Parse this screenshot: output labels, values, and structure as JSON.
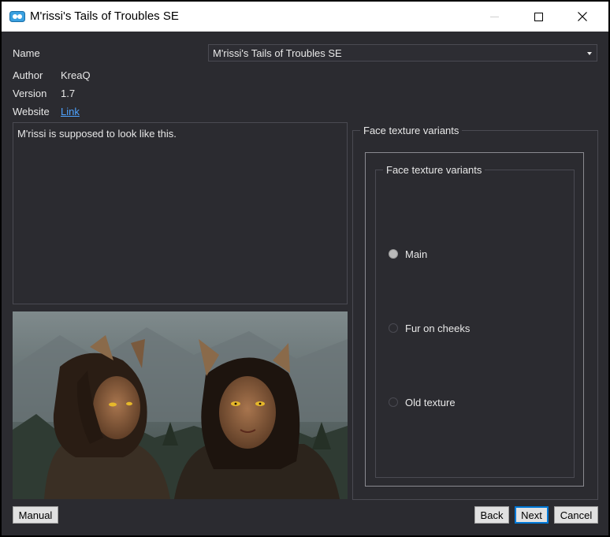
{
  "window": {
    "title": "M'rissi's Tails of Troubles SE"
  },
  "info": {
    "name_label": "Name",
    "name_value": "M'rissi's Tails of Troubles SE",
    "author_label": "Author",
    "author_value": "KreaQ",
    "version_label": "Version",
    "version_value": "1.7",
    "website_label": "Website",
    "website_link": "Link"
  },
  "description": "M'rissi is supposed to look like this.",
  "options": {
    "outer_group_title": "Face texture variants",
    "inner_group_title": "Face texture variants",
    "items": [
      {
        "label": "Main",
        "checked": true
      },
      {
        "label": "Fur on cheeks",
        "checked": false
      },
      {
        "label": "Old texture",
        "checked": false
      }
    ]
  },
  "buttons": {
    "manual": "Manual",
    "back": "Back",
    "next": "Next",
    "cancel": "Cancel"
  },
  "colors": {
    "background": "#2b2b30",
    "link": "#4ea3ff",
    "accent": "#0078d7"
  }
}
